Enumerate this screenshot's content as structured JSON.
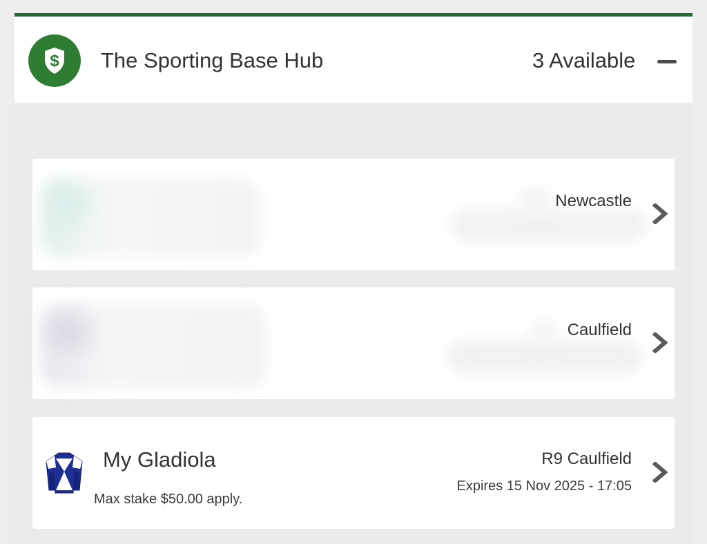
{
  "hub": {
    "title": "The Sporting Base Hub",
    "available": "3 Available",
    "icon": "shield-dollar-icon",
    "accent_color": "#2e7d32",
    "header_border_color": "#1f6b35"
  },
  "cards": [
    {
      "location": "Newcastle",
      "arrow_icon": "chevron-right-icon"
    },
    {
      "location": "Caulfield",
      "arrow_icon": "chevron-right-icon"
    },
    {
      "runner": "My Gladiola",
      "stake": "Max stake $50.00 apply.",
      "location": "R9 Caulfield",
      "expiry": "Expires 15 Nov 2025 - 17:05",
      "silks_icon": "jockey-silks-icon",
      "arrow_icon": "chevron-right-icon"
    }
  ],
  "colors": {
    "page_background": "#ededed",
    "card_background": "#ffffff",
    "text_primary": "#333333",
    "chevron": "#5a5a5a",
    "silks_blue": "#1d2f95"
  }
}
